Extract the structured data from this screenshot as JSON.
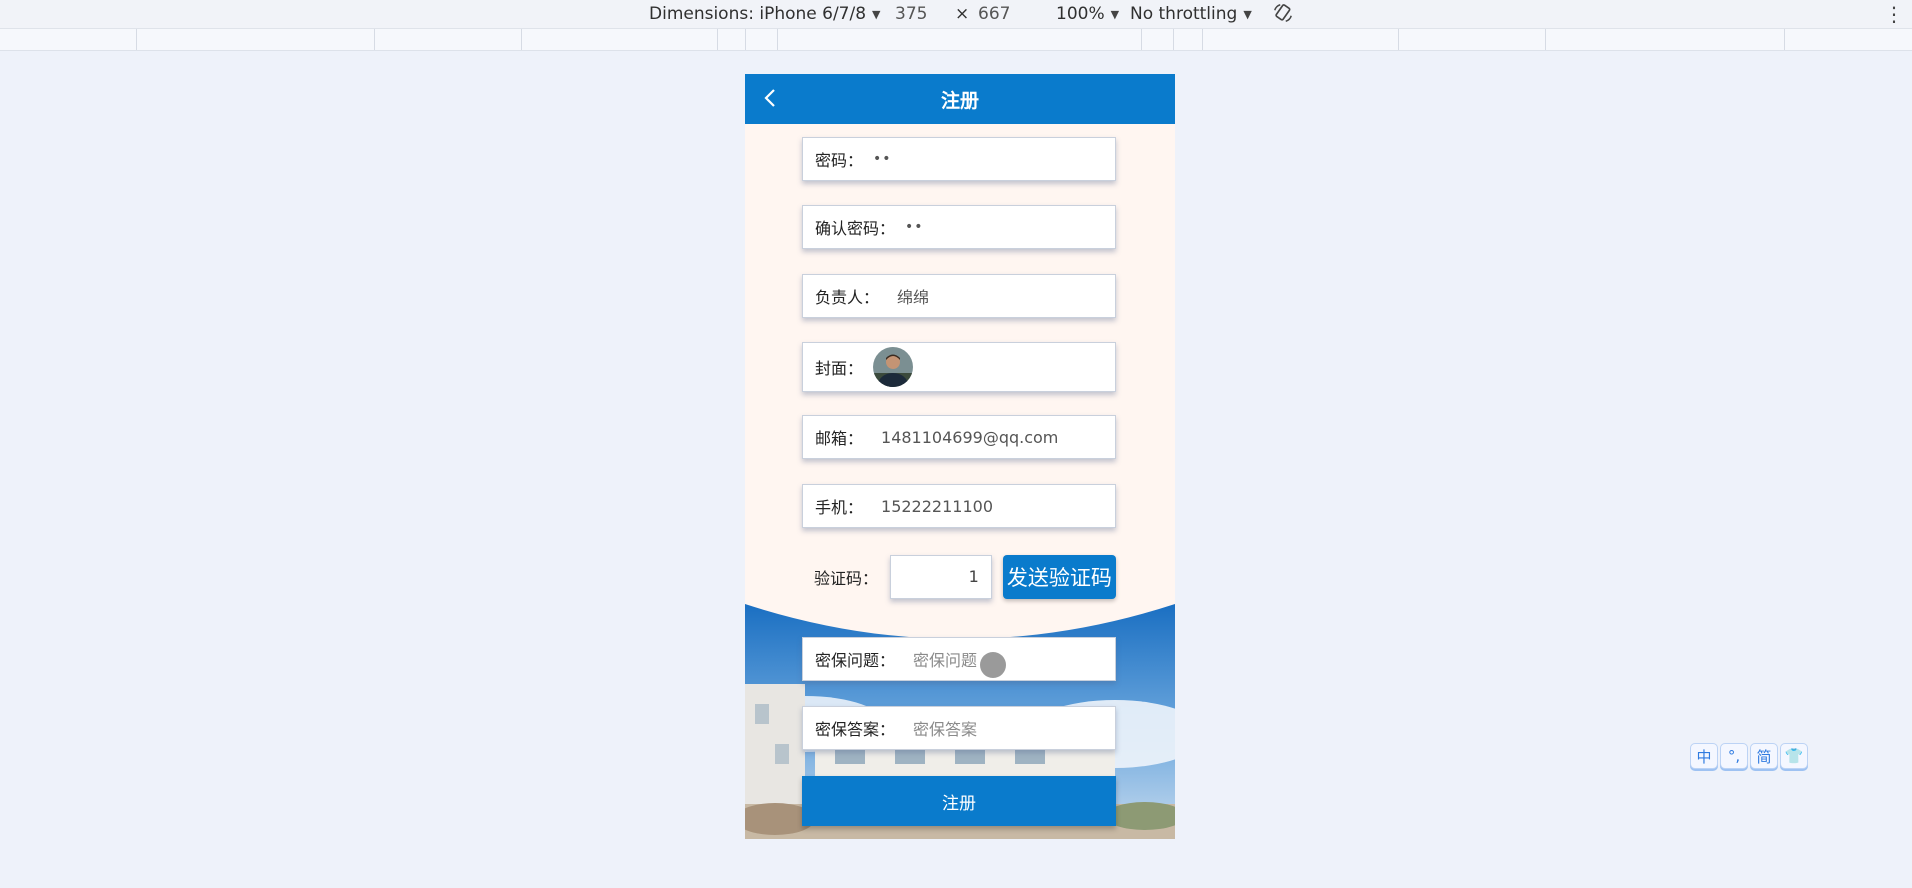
{
  "devtools": {
    "dimensions_label": "Dimensions: iPhone 6/7/8",
    "width": "375",
    "times": "×",
    "height": "667",
    "zoom": "100%",
    "throttling": "No throttling"
  },
  "page": {
    "title": "注册",
    "fields": {
      "password": {
        "label": "密码：",
        "value": "••"
      },
      "confirm": {
        "label": "确认密码：",
        "value": "••"
      },
      "owner": {
        "label": "负责人：",
        "value": "绵绵"
      },
      "cover": {
        "label": "封面："
      },
      "email": {
        "label": "邮箱：",
        "value": "1481104699@qq.com"
      },
      "phone": {
        "label": "手机：",
        "value": "15222211100"
      },
      "code": {
        "label": "验证码：",
        "value": "1",
        "send_label": "发送验证码"
      },
      "question": {
        "label": "密保问题：",
        "placeholder": "密保问题"
      },
      "answer": {
        "label": "密保答案：",
        "placeholder": "密保答案"
      }
    },
    "submit_label": "注册"
  },
  "ime": {
    "keys": [
      "中",
      "°,",
      "简",
      "👕"
    ]
  },
  "colors": {
    "primary": "#0a7bcc",
    "page_bg": "#eef2fa"
  }
}
